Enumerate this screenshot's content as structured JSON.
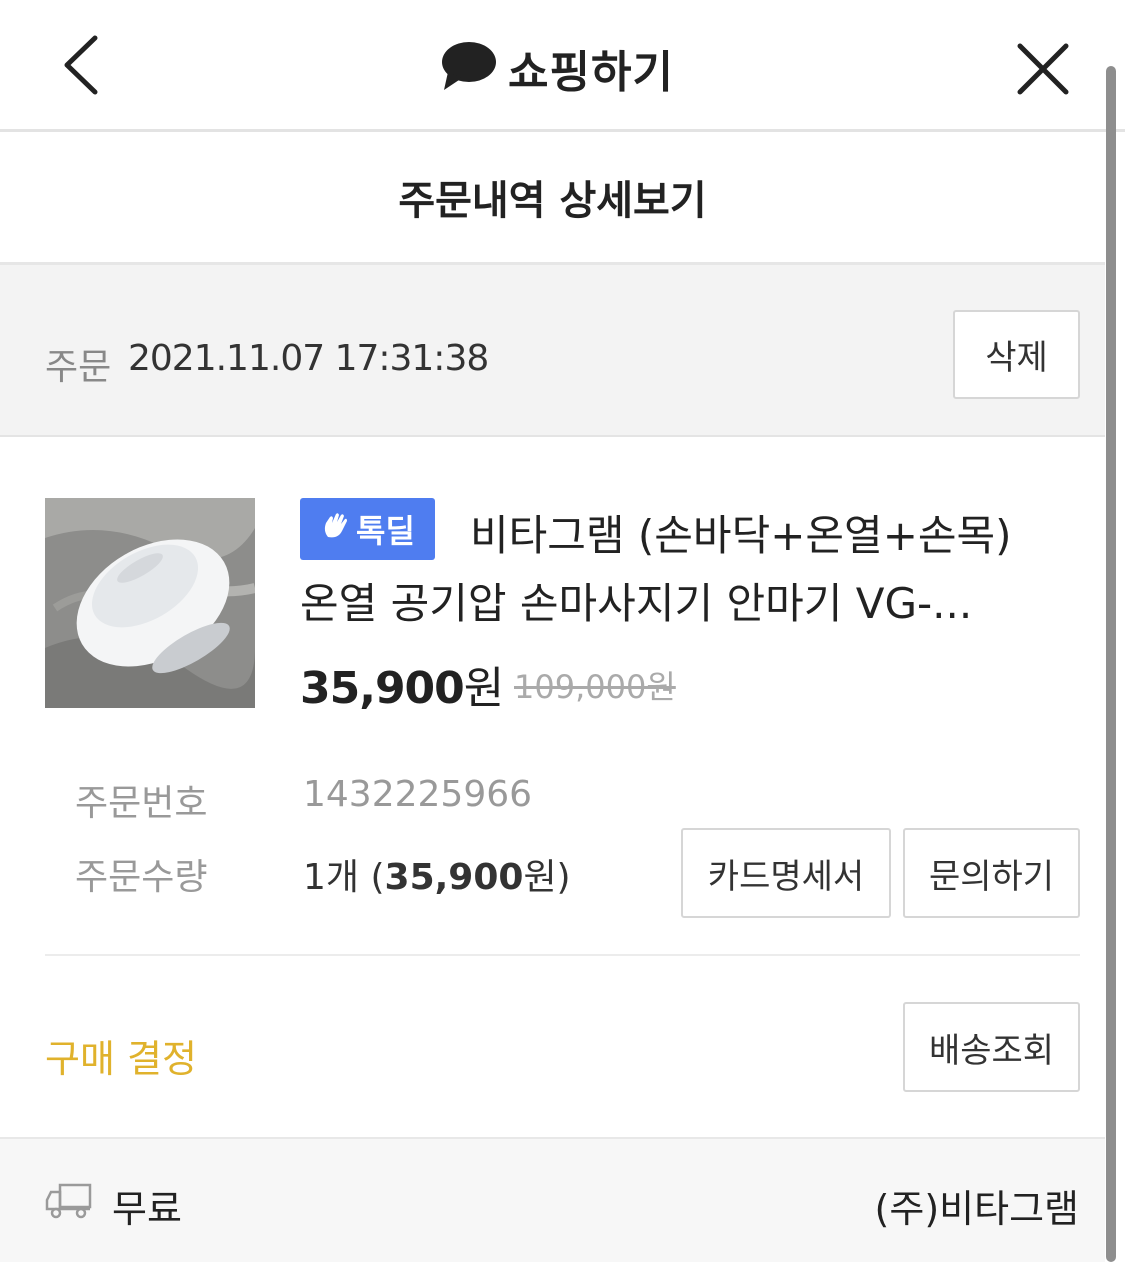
{
  "topbar": {
    "title": "쇼핑하기",
    "back_icon": "chevron-left-icon",
    "close_icon": "close-icon",
    "logo_icon": "speech-bubble-icon"
  },
  "page": {
    "title": "주문내역 상세보기"
  },
  "order": {
    "label": "주문",
    "datetime": "2021.11.07 17:31:38",
    "delete_label": "삭제"
  },
  "product": {
    "badge": "톡딜",
    "title_line1": "비타그램 (손바닥+온열+손목)",
    "title_line2": "온열 공기압 손마사지기 안마기 VG-...",
    "price": "35,900",
    "price_unit": "원",
    "original_price": "109,000원"
  },
  "details": {
    "order_number_label": "주문번호",
    "order_number": "1432225966",
    "quantity_label": "주문수량",
    "quantity_prefix": "1개 (",
    "quantity_price": "35,900",
    "quantity_suffix": "원)"
  },
  "buttons": {
    "card_statement": "카드명세서",
    "inquiry": "문의하기",
    "tracking": "배송조회"
  },
  "purchase": {
    "decide_label": "구매 결정"
  },
  "footer": {
    "shipping": "무료",
    "seller": "(주)비타그램"
  },
  "colors": {
    "badge": "#4f7df0",
    "decide": "#e0b22c"
  }
}
